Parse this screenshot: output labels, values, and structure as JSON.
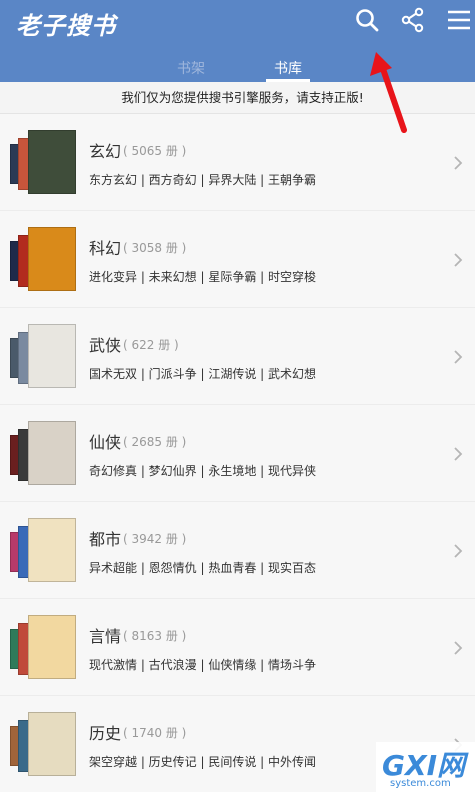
{
  "header": {
    "app_title": "老子搜书",
    "tabs": [
      {
        "label": "书架"
      },
      {
        "label": "书库"
      }
    ],
    "accent_color": "#5a86c6"
  },
  "notice": "我们仅为您提供搜书引擎服务，请支持正版!",
  "categories": [
    {
      "name": "玄幻",
      "count": "( 5065 册 )",
      "subcategories": "东方玄幻 | 西方奇幻 | 异界大陆 | 王朝争霸",
      "cover_colors": [
        "#2b3a55",
        "#c7553b",
        "#3f4d3a"
      ]
    },
    {
      "name": "科幻",
      "count": "( 3058 册 )",
      "subcategories": "进化变异 | 未来幻想 | 星际争霸 | 时空穿梭",
      "cover_colors": [
        "#1f2a4a",
        "#b22b1e",
        "#d98a1a"
      ]
    },
    {
      "name": "武侠",
      "count": "( 622 册 )",
      "subcategories": "国术无双 | 门派斗争 | 江湖传说 | 武术幻想",
      "cover_colors": [
        "#4a5a6a",
        "#7a8aa0",
        "#e8e6e0"
      ]
    },
    {
      "name": "仙侠",
      "count": "( 2685 册 )",
      "subcategories": "奇幻修真 | 梦幻仙界 | 永生境地 | 现代异侠",
      "cover_colors": [
        "#6a1f1f",
        "#3a3a3a",
        "#d9d2c7"
      ]
    },
    {
      "name": "都市",
      "count": "( 3942 册 )",
      "subcategories": "异术超能 | 恩怨情仇 | 热血青春 | 现实百态",
      "cover_colors": [
        "#b83a6a",
        "#3a6ab8",
        "#f0e2c0"
      ]
    },
    {
      "name": "言情",
      "count": "( 8163 册 )",
      "subcategories": "现代激情 | 古代浪漫 | 仙侠情缘 | 情场斗争",
      "cover_colors": [
        "#2f7a5a",
        "#c04a3a",
        "#f2d8a0"
      ]
    },
    {
      "name": "历史",
      "count": "( 1740 册 )",
      "subcategories": "架空穿越 | 历史传记 | 民间传说 | 中外传闻",
      "cover_colors": [
        "#a0643a",
        "#3a6a8a",
        "#e6dcc0"
      ]
    }
  ],
  "watermark": {
    "main": "GXI网",
    "sub": "system.com"
  },
  "icons": {
    "search": "search-icon",
    "share": "share-icon",
    "menu": "menu-icon",
    "chevron": "chevron-right-icon",
    "arrow": "red-arrow-annotation"
  }
}
